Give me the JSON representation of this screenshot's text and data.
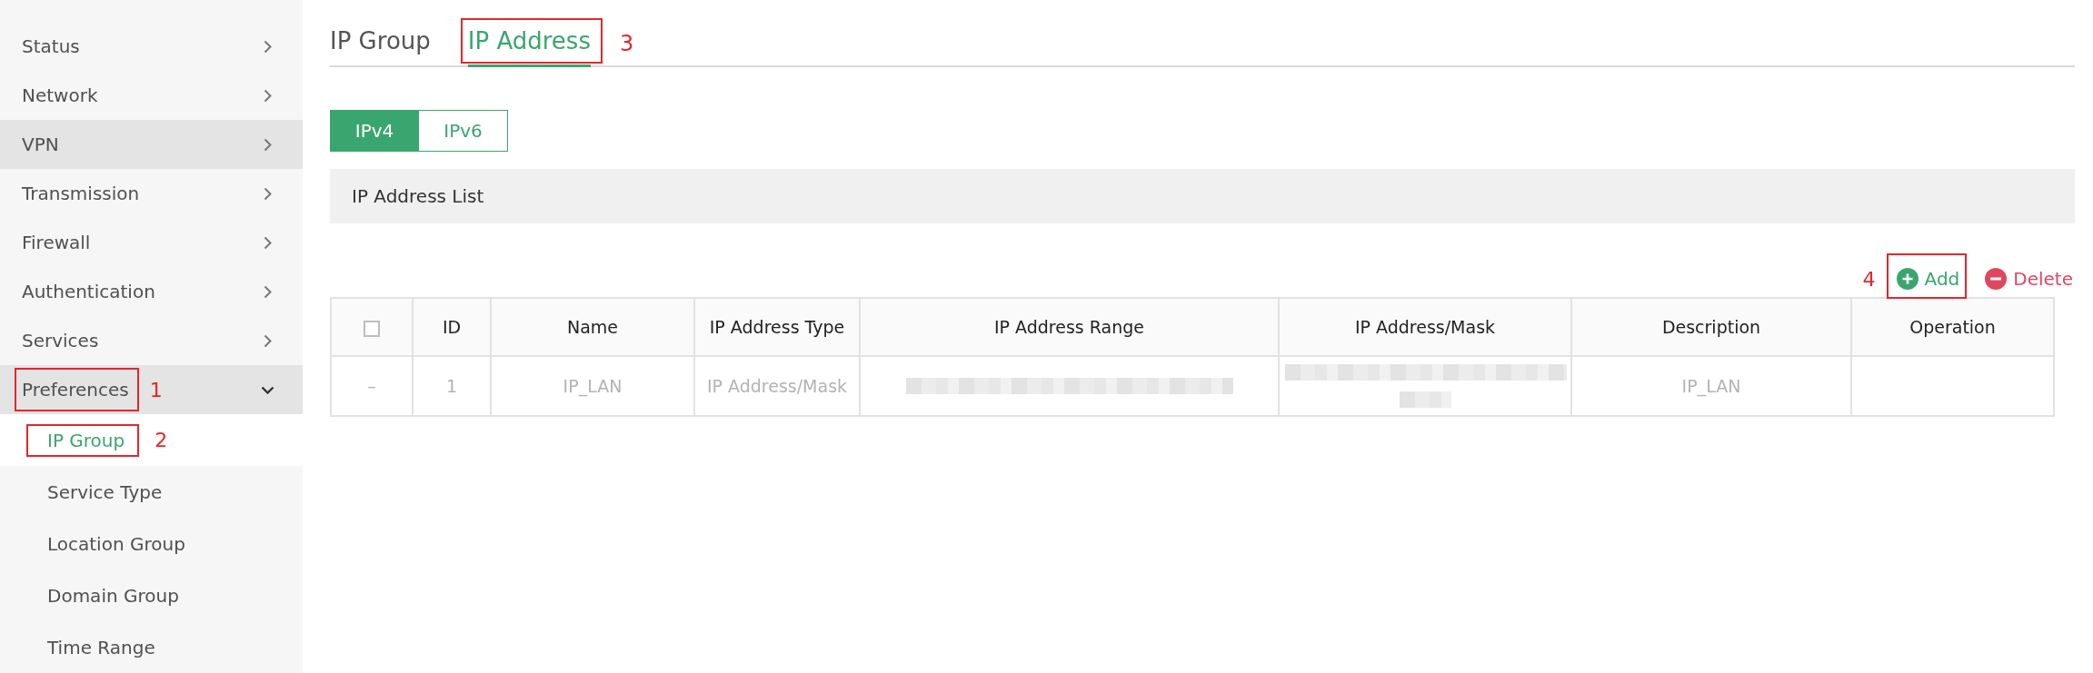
{
  "sidebar": {
    "items": [
      {
        "label": "Status",
        "highlighted": false,
        "expanded": false
      },
      {
        "label": "Network",
        "highlighted": false,
        "expanded": false
      },
      {
        "label": "VPN",
        "highlighted": true,
        "expanded": false
      },
      {
        "label": "Transmission",
        "highlighted": false,
        "expanded": false
      },
      {
        "label": "Firewall",
        "highlighted": false,
        "expanded": false
      },
      {
        "label": "Authentication",
        "highlighted": false,
        "expanded": false
      },
      {
        "label": "Services",
        "highlighted": false,
        "expanded": false
      },
      {
        "label": "Preferences",
        "highlighted": true,
        "expanded": true,
        "callout": "1",
        "children": [
          {
            "label": "IP Group",
            "selected": true,
            "callout": "2"
          },
          {
            "label": "Service Type",
            "selected": false
          },
          {
            "label": "Location Group",
            "selected": false
          },
          {
            "label": "Domain Group",
            "selected": false
          },
          {
            "label": "Time Range",
            "selected": false
          }
        ]
      }
    ]
  },
  "tabs": [
    {
      "label": "IP Group",
      "selected": false
    },
    {
      "label": "IP Address",
      "selected": true,
      "callout": "3"
    }
  ],
  "ip_versions": [
    {
      "label": "IPv4",
      "selected": true
    },
    {
      "label": "IPv6",
      "selected": false
    }
  ],
  "section": {
    "title": "IP Address List"
  },
  "actions": [
    {
      "kind": "add",
      "label": "Add",
      "callout": "4"
    },
    {
      "kind": "delete",
      "label": "Delete"
    }
  ],
  "table": {
    "columns": [
      {
        "kind": "checkbox",
        "checked": false
      },
      {
        "kind": "text",
        "label": "ID"
      },
      {
        "kind": "text",
        "label": "Name"
      },
      {
        "kind": "text",
        "label": "IP Address Type"
      },
      {
        "kind": "text",
        "label": "IP Address Range"
      },
      {
        "kind": "text",
        "label": "IP Address/Mask"
      },
      {
        "kind": "text",
        "label": "Description"
      },
      {
        "kind": "text",
        "label": "Operation"
      }
    ],
    "rows": [
      {
        "cells": [
          {
            "kind": "text",
            "text": "–"
          },
          {
            "kind": "text",
            "text": "1"
          },
          {
            "kind": "text",
            "text": "IP_LAN"
          },
          {
            "kind": "text",
            "text": "IP Address/Mask"
          },
          {
            "kind": "blurred",
            "wrapped": false
          },
          {
            "kind": "blurred",
            "wrapped": true
          },
          {
            "kind": "text",
            "text": "IP_LAN"
          },
          {
            "kind": "empty"
          }
        ]
      }
    ]
  }
}
